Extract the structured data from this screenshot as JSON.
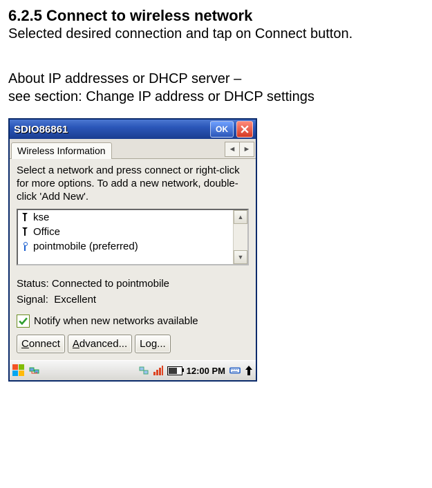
{
  "doc": {
    "heading": "6.2.5 Connect to wireless network",
    "instruction": "Selected desired connection and tap on Connect button.",
    "ip_line1": "About IP addresses or DHCP server –",
    "ip_line2": "see section: Change IP address or DHCP settings"
  },
  "window": {
    "title": "SDIO86861",
    "ok_label": "OK",
    "tab_label": "Wireless Information",
    "help_text": "Select a network and press connect or right-click for more options.  To add a new network, double-click 'Add New'.",
    "networks": [
      {
        "name": "kse",
        "preferred": false
      },
      {
        "name": "Office",
        "preferred": false
      },
      {
        "name": "pointmobile (preferred)",
        "preferred": true
      }
    ],
    "status_label": "Status:",
    "status_value": "Connected to pointmobile",
    "signal_label": "Signal:",
    "signal_value": "Excellent",
    "notify_label": "Notify when new networks available",
    "notify_checked": true,
    "buttons": {
      "connect": "Connect",
      "advanced": "Advanced...",
      "log": "Log..."
    },
    "taskbar": {
      "time": "12:00 PM"
    }
  }
}
